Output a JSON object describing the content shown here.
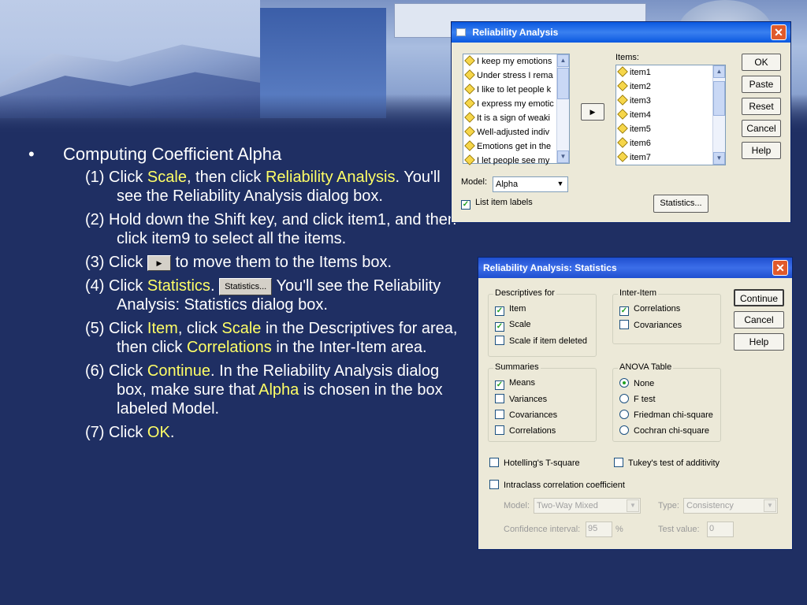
{
  "slide": {
    "bullet_marker": "•",
    "heading": "Computing Coefficient Alpha",
    "steps": [
      {
        "num": "(1)",
        "parts": [
          {
            "t": "Click "
          },
          {
            "t": "Scale",
            "hl": true
          },
          {
            "t": ", then click "
          },
          {
            "t": "Reliability Analysis",
            "hl": true
          },
          {
            "t": ". You'll see the Reliability Analysis dialog box."
          }
        ]
      },
      {
        "num": "(2)",
        "parts": [
          {
            "t": "Hold down the Shift key, and click item1, and then click item9 to select all the items."
          }
        ]
      },
      {
        "num": "(3)",
        "parts": [
          {
            "t": "Click "
          },
          {
            "btn": "arrow"
          },
          {
            "t": "  to move them to the Items box."
          }
        ]
      },
      {
        "num": "(4)",
        "parts": [
          {
            "t": "Click "
          },
          {
            "t": "Statistics",
            "hl": true
          },
          {
            "t": ".  "
          },
          {
            "btn": "statistics"
          },
          {
            "t": "          You'll see the Reliability Analysis: Statistics dialog box."
          }
        ]
      },
      {
        "num": "(5)",
        "parts": [
          {
            "t": "Click "
          },
          {
            "t": "Item",
            "hl": true
          },
          {
            "t": ", click "
          },
          {
            "t": "Scale",
            "hl": true
          },
          {
            "t": " in the Descriptives for area, then click "
          },
          {
            "t": "Correlations",
            "hl": true
          },
          {
            "t": " in the Inter-Item area."
          }
        ]
      },
      {
        "num": "(6)",
        "parts": [
          {
            "t": "Click "
          },
          {
            "t": "Continue",
            "hl": true
          },
          {
            "t": ". In the Reliability Analysis dialog box, make sure that "
          },
          {
            "t": "Alpha",
            "hl": true
          },
          {
            "t": " is chosen in the box labeled Model."
          }
        ]
      },
      {
        "num": "(7)",
        "parts": [
          {
            "t": "Click "
          },
          {
            "t": "OK",
            "hl": true
          },
          {
            "t": "."
          }
        ]
      }
    ],
    "inline_statistics_label": "Statistics..."
  },
  "dialog1": {
    "title": "Reliability Analysis",
    "close": "✕",
    "source_list": [
      "I keep my emotions",
      "Under stress I rema",
      "I like to let people k",
      "I express my emotic",
      "It is a sign of weaki",
      "Well-adjusted indiv",
      "Emotions get in the",
      "I let people see my"
    ],
    "items_label": "Items:",
    "items_list": [
      "item1",
      "item2",
      "item3",
      "item4",
      "item5",
      "item6",
      "item7"
    ],
    "move_arrow": "▶",
    "buttons": [
      "OK",
      "Paste",
      "Reset",
      "Cancel",
      "Help"
    ],
    "model_label": "Model:",
    "model_value": "Alpha",
    "list_item_labels": "List item labels",
    "list_item_labels_checked": true,
    "statistics_button": "Statistics..."
  },
  "dialog2": {
    "title": "Reliability Analysis: Statistics",
    "close": "✕",
    "descriptives": {
      "title": "Descriptives for",
      "items": [
        {
          "label": "Item",
          "checked": true
        },
        {
          "label": "Scale",
          "checked": true
        },
        {
          "label": "Scale if item deleted",
          "checked": false
        }
      ]
    },
    "inter_item": {
      "title": "Inter-Item",
      "items": [
        {
          "label": "Correlations",
          "checked": true
        },
        {
          "label": "Covariances",
          "checked": false
        }
      ]
    },
    "summaries": {
      "title": "Summaries",
      "items": [
        {
          "label": "Means",
          "checked": true
        },
        {
          "label": "Variances",
          "checked": false
        },
        {
          "label": "Covariances",
          "checked": false
        },
        {
          "label": "Correlations",
          "checked": false
        }
      ]
    },
    "anova": {
      "title": "ANOVA Table",
      "items": [
        {
          "label": "None",
          "selected": true
        },
        {
          "label": "F test",
          "selected": false
        },
        {
          "label": "Friedman chi-square",
          "selected": false
        },
        {
          "label": "Cochran chi-square",
          "selected": false
        }
      ]
    },
    "buttons": [
      "Continue",
      "Cancel",
      "Help"
    ],
    "hotelling": {
      "label": "Hotelling's T-square",
      "checked": false
    },
    "tukey": {
      "label": "Tukey's test of additivity",
      "checked": false
    },
    "intraclass": {
      "label": "Intraclass correlation coefficient",
      "checked": false
    },
    "model_label": "Model:",
    "model_value": "Two-Way Mixed",
    "type_label": "Type:",
    "type_value": "Consistency",
    "ci_label": "Confidence interval:",
    "ci_value": "95",
    "ci_unit": "%",
    "test_value_label": "Test value:",
    "test_value": "0"
  },
  "colors": {
    "background": "#1f2f63",
    "highlight": "#ffff66",
    "titlebar": "#0a58e0",
    "check": "#21a121"
  }
}
